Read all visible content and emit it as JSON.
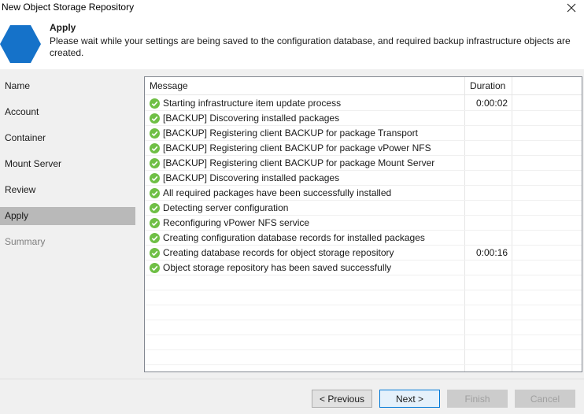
{
  "window": {
    "title": "New Object Storage Repository"
  },
  "header": {
    "title": "Apply",
    "description": "Please wait while your settings are being saved to the configuration database, and required backup infrastructure objects are created."
  },
  "sidebar": {
    "items": [
      {
        "label": "Name",
        "state": "normal"
      },
      {
        "label": "Account",
        "state": "normal"
      },
      {
        "label": "Container",
        "state": "normal"
      },
      {
        "label": "Mount Server",
        "state": "normal"
      },
      {
        "label": "Review",
        "state": "normal"
      },
      {
        "label": "Apply",
        "state": "active"
      },
      {
        "label": "Summary",
        "state": "disabled"
      }
    ]
  },
  "log": {
    "columns": {
      "message": "Message",
      "duration": "Duration"
    },
    "rows": [
      {
        "message": "Starting infrastructure item update process",
        "duration": "0:00:02"
      },
      {
        "message": "[BACKUP] Discovering installed packages",
        "duration": ""
      },
      {
        "message": "[BACKUP] Registering client BACKUP for package Transport",
        "duration": ""
      },
      {
        "message": "[BACKUP] Registering client BACKUP for package vPower NFS",
        "duration": ""
      },
      {
        "message": "[BACKUP] Registering client BACKUP for package Mount Server",
        "duration": ""
      },
      {
        "message": "[BACKUP] Discovering installed packages",
        "duration": ""
      },
      {
        "message": "All required packages have been successfully installed",
        "duration": ""
      },
      {
        "message": "Detecting server configuration",
        "duration": ""
      },
      {
        "message": "Reconfiguring vPower NFS service",
        "duration": ""
      },
      {
        "message": "Creating configuration database records for installed packages",
        "duration": ""
      },
      {
        "message": "Creating database records for object storage repository",
        "duration": "0:00:16"
      },
      {
        "message": "Object storage repository has been saved successfully",
        "duration": ""
      }
    ]
  },
  "footer": {
    "previous": "< Previous",
    "next": "Next >",
    "finish": "Finish",
    "cancel": "Cancel"
  },
  "colors": {
    "accent": "#0078d7",
    "hexagon": "#1572c9",
    "success": "#6fbf45",
    "active_nav": "#b9b9b9"
  },
  "icons": {
    "header": "hexagon-icon",
    "close": "close-icon",
    "row_status": "success-check-icon"
  }
}
